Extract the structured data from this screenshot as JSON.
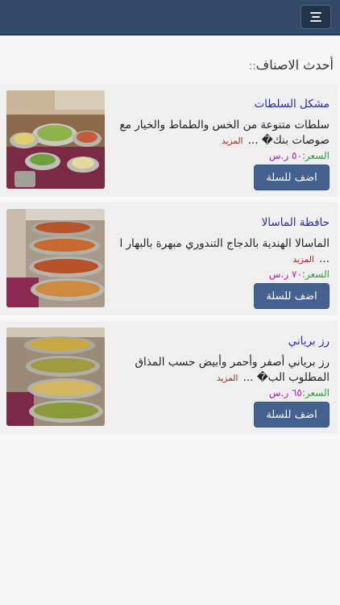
{
  "header": {
    "menu_icon": "hamburger-menu-icon"
  },
  "section": {
    "title": "أحدث الاصناف",
    "dots": "::"
  },
  "colors": {
    "header_bg": "#344a66",
    "button_bg": "#44618f",
    "name": "#2a2ab0",
    "more": "#b02020",
    "price_label": "#2aa040",
    "price_value": "#b020b0"
  },
  "items": [
    {
      "name": "مشكل السلطات",
      "desc": "سلطات متنوعة من الخس والطماط والخيار مع صوصات بنك�",
      "more_prefix": " ...",
      "more": "المزيد",
      "price_label": "السعر:",
      "price_value": "٥٠ ر.س",
      "button": "اضف للسلة"
    },
    {
      "name": "حافظة الماسالا",
      "desc": "الماسالا الهندية بالدجاج التندوري مبهرة بالبهار ا",
      "more_prefix": " ...",
      "more": "المزيد",
      "price_label": "السعر:",
      "price_value": "٧٠ ر.س",
      "button": "اضف للسلة"
    },
    {
      "name": "رز برياني",
      "desc": "رز برياني أصفر وأحمر وأبيض حسب المذاق المطلوب الب�",
      "more_prefix": " ...",
      "more": "المزيد",
      "price_label": "السعر:",
      "price_value": "٦٥ ر.س",
      "button": "اضف للسلة"
    }
  ]
}
